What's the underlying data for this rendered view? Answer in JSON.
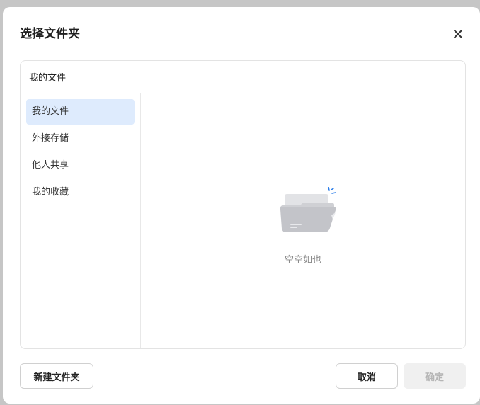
{
  "dialog": {
    "title": "选择文件夹",
    "close_icon": "close-icon"
  },
  "path_bar": {
    "current_path": "我的文件"
  },
  "sidebar": {
    "items": [
      {
        "label": "我的文件",
        "active": true
      },
      {
        "label": "外接存储",
        "active": false
      },
      {
        "label": "他人共享",
        "active": false
      },
      {
        "label": "我的收藏",
        "active": false
      }
    ]
  },
  "content": {
    "empty_icon": "empty-folder-icon",
    "empty_text": "空空如也"
  },
  "footer": {
    "new_folder_label": "新建文件夹",
    "cancel_label": "取消",
    "confirm_label": "确定",
    "confirm_disabled": true
  },
  "colors": {
    "active_item_bg": "#deebfd",
    "accent": "#2b7de9",
    "disabled_bg": "#f0f0f0",
    "disabled_text": "#b5b5b5"
  }
}
